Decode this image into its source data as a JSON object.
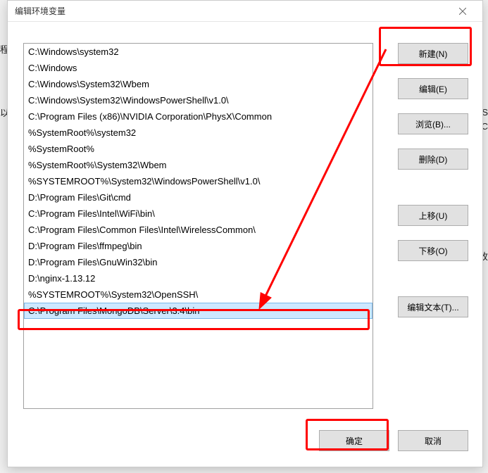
{
  "dialog": {
    "title": "编辑环境变量"
  },
  "paths": [
    "C:\\Windows\\system32",
    "C:\\Windows",
    "C:\\Windows\\System32\\Wbem",
    "C:\\Windows\\System32\\WindowsPowerShell\\v1.0\\",
    "C:\\Program Files (x86)\\NVIDIA Corporation\\PhysX\\Common",
    "%SystemRoot%\\system32",
    "%SystemRoot%",
    "%SystemRoot%\\System32\\Wbem",
    "%SYSTEMROOT%\\System32\\WindowsPowerShell\\v1.0\\",
    "D:\\Program Files\\Git\\cmd",
    "C:\\Program Files\\Intel\\WiFi\\bin\\",
    "C:\\Program Files\\Common Files\\Intel\\WirelessCommon\\",
    "D:\\Program Files\\ffmpeg\\bin",
    "D:\\Program Files\\GnuWin32\\bin",
    "D:\\nginx-1.13.12",
    "%SYSTEMROOT%\\System32\\OpenSSH\\",
    "C:\\Program Files\\MongoDB\\Server\\3.4\\bin"
  ],
  "selectedIndex": 16,
  "buttons": {
    "new": "新建(N)",
    "edit": "编辑(E)",
    "browse": "浏览(B)...",
    "delete": "删除(D)",
    "moveUp": "上移(U)",
    "moveDown": "下移(O)",
    "editText": "编辑文本(T)...",
    "ok": "确定",
    "cancel": "取消"
  },
  "bg": {
    "t1": "程",
    "t2": "以",
    "t3": "S",
    "t4": "C",
    "t5": "改"
  }
}
